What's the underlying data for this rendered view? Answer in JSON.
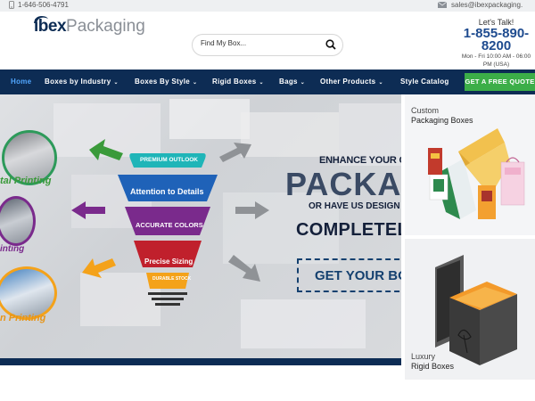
{
  "topbar": {
    "phone": "1-646-506-4791",
    "email": "sales@ibexpackaging."
  },
  "header": {
    "logo_bold": "ibex",
    "logo_light": "Packaging",
    "search_placeholder": "Find My Box...",
    "lets_talk": "Let's Talk!",
    "phone_big": "1-855-890-8200",
    "hours": "Mon - Fri 10:00 AM - 06:00",
    "hours_tz": "PM (USA)"
  },
  "nav": {
    "items": [
      {
        "label": "Home",
        "dropdown": false
      },
      {
        "label": "Boxes by Industry",
        "dropdown": true
      },
      {
        "label": "Boxes By Style",
        "dropdown": true
      },
      {
        "label": "Rigid Boxes",
        "dropdown": true
      },
      {
        "label": "Bags",
        "dropdown": true
      },
      {
        "label": "Other Products",
        "dropdown": true
      },
      {
        "label": "Style Catalog",
        "dropdown": false
      }
    ],
    "cta": "GET A FREE QUOTE"
  },
  "hero": {
    "funnel": [
      "PREMIUM OUTLOOK",
      "Attention to Details",
      "ACCURATE COLORS",
      "Precise Sizing",
      "DURABLE STOCK"
    ],
    "left_labels": [
      "tal Printing",
      "inting",
      "n Printing"
    ],
    "enhance": "ENHANCE YOUR CURRE",
    "packag": "PACKAG",
    "or_have": "OR HAVE US DESIGN SOME",
    "completely": "COMPLETELY",
    "get_boxes": "GET YOUR BOXE",
    "dots": 4,
    "active_dot": 0
  },
  "side": {
    "top_line1": "Custom",
    "top_line2": "Packaging Boxes",
    "bot_line1": "Luxury",
    "bot_line2": "Rigid Boxes"
  },
  "colors": {
    "navy": "#0d2c54",
    "accent_blue": "#52a7ff",
    "cta_green": "#3cae48",
    "funnel_teal": "#1fb5b8",
    "funnel_blue": "#1f62b8",
    "funnel_purple": "#7a2a8c",
    "funnel_red": "#c0202c",
    "funnel_orange": "#f4a21a"
  }
}
